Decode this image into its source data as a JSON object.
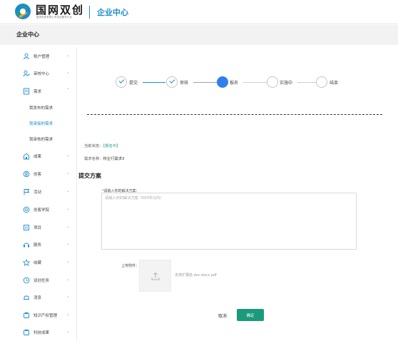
{
  "header": {
    "logo_title": "国网双创",
    "logo_subtitle": "国家电网有限公司双创服务平台",
    "section_title": "企业中心",
    "brand_colors": {
      "blue": "#1a8ccf",
      "green": "#2aa651",
      "orange": "#f0a21c"
    }
  },
  "page": {
    "title": "企业中心"
  },
  "sidebar": {
    "items": [
      {
        "label": "账户管理",
        "icon": "user-icon",
        "expanded": false
      },
      {
        "label": "审核中心",
        "icon": "audit-icon",
        "expanded": false
      },
      {
        "label": "需求",
        "icon": "document-icon",
        "expanded": true
      },
      {
        "label": "成果",
        "icon": "building-icon",
        "expanded": false
      },
      {
        "label": "创客",
        "icon": "maker-icon",
        "expanded": false
      },
      {
        "label": "活动",
        "icon": "flag-icon",
        "expanded": false
      },
      {
        "label": "创客学院",
        "icon": "academy-icon",
        "expanded": false
      },
      {
        "label": "项目",
        "icon": "project-icon",
        "expanded": false
      },
      {
        "label": "服务",
        "icon": "service-icon",
        "expanded": false
      },
      {
        "label": "收藏",
        "icon": "star-icon",
        "expanded": false
      },
      {
        "label": "双创任务",
        "icon": "task-icon",
        "expanded": false
      },
      {
        "label": "消息",
        "icon": "bell-icon",
        "expanded": false
      },
      {
        "label": "知识产权管理",
        "icon": "ip-icon",
        "expanded": false
      },
      {
        "label": "科技成果",
        "icon": "tech-icon",
        "expanded": false
      }
    ],
    "sub_items": [
      {
        "label": "我发布的需求",
        "active": false
      },
      {
        "label": "我承接的需求",
        "active": true
      },
      {
        "label": "我审核的需求",
        "active": false
      }
    ]
  },
  "steps": [
    {
      "label": "提交",
      "state": "done"
    },
    {
      "label": "审核",
      "state": "done"
    },
    {
      "label": "报名",
      "state": "current"
    },
    {
      "label": "实施中",
      "state": "pending"
    },
    {
      "label": "结束",
      "state": "pending"
    }
  ],
  "info": {
    "status_label": "当前状态：",
    "status_value": "【报名中】",
    "name_label": "需求名称：",
    "name_value": "校企行需求3"
  },
  "form": {
    "section_title": "提交方案",
    "required_mark": "*",
    "solution_label": "请输入你的解决方案：",
    "solution_placeholder": "请输入你的解决方案（500字以内）",
    "solution_value": "",
    "upload_label": "上传附件：",
    "upload_hint": "支持扩展名.doc.docx.pdf",
    "cancel_label": "取消",
    "ok_label": "确定"
  },
  "colors": {
    "accent": "#1a8ccf",
    "step_current": "#2f80ed",
    "status_text": "#1a9a8a",
    "primary_button": "#1a9a7a",
    "required": "#ee3333"
  }
}
